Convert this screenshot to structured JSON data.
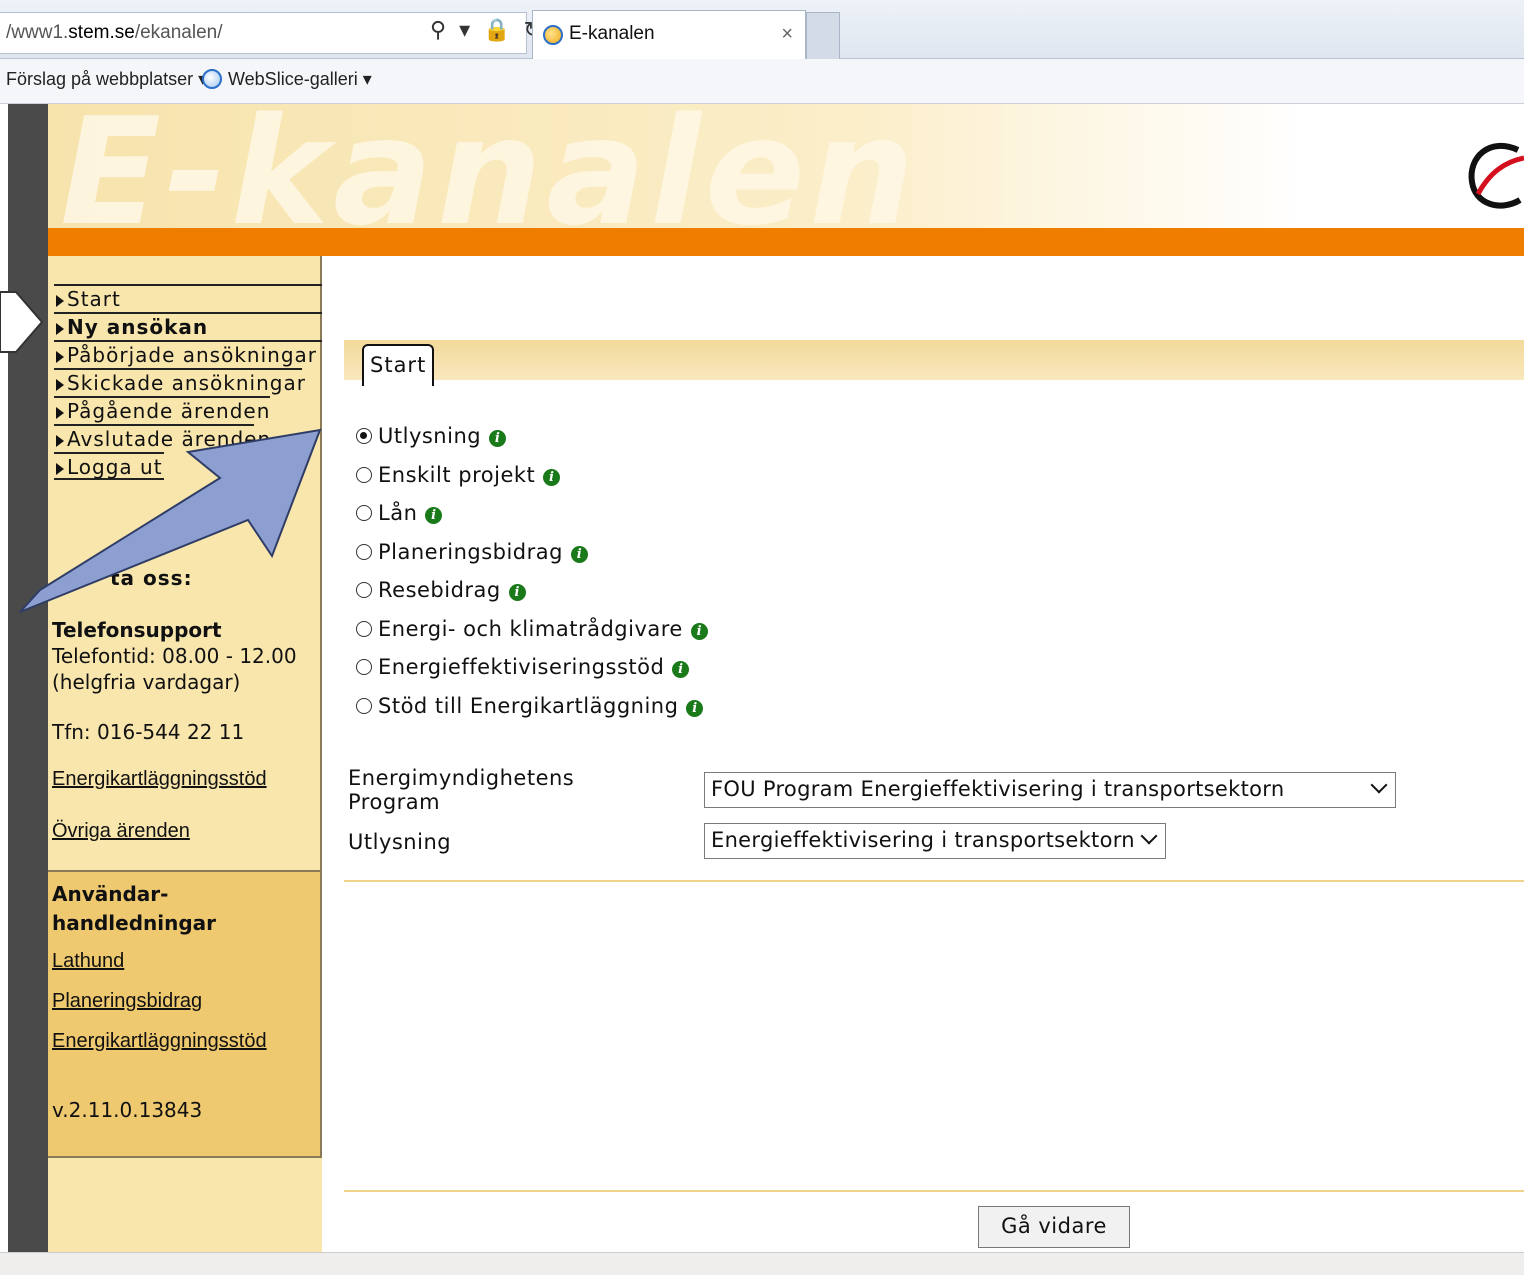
{
  "browser": {
    "url_prefix": "/www1.",
    "url_domain": "stem.se",
    "url_path": "/ekanalen/",
    "tab_title": "E-kanalen",
    "tab_close": "×",
    "fav_suggest": "Förslag på webbplatser ▾",
    "fav_webslice": "WebSlice-galleri ▾",
    "url_tools": "⚲ ▾ 🔒 ↻"
  },
  "header": {
    "logo": "E-kanalen"
  },
  "nav": {
    "items": [
      {
        "label": "Start"
      },
      {
        "label": "Ny ansökan"
      },
      {
        "label": "Påbörjade ansökningar"
      },
      {
        "label": "Skickade ansökningar"
      },
      {
        "label": "Pågående ärenden"
      },
      {
        "label": "Avslutade ärenden"
      },
      {
        "label": "Logga ut"
      }
    ]
  },
  "contact": {
    "title": "ta oss:",
    "support_title": "Telefonsupport",
    "hours": "Telefontid: 08.00 - 12.00",
    "days": "(helgfria vardagar)",
    "phone": "Tfn: 016-544 22 11",
    "link1": "Energikartläggningsstöd",
    "link2": "Övriga ärenden"
  },
  "guides": {
    "title_line1": "Användar-",
    "title_line2": "handledningar",
    "link1": "Lathund",
    "link2": "Planeringsbidrag",
    "link3": "Energikartläggningsstöd",
    "version": "v.2.11.0.13843"
  },
  "main": {
    "tab_label": "Start",
    "radios": [
      {
        "label": "Utlysning",
        "selected": true
      },
      {
        "label": "Enskilt projekt",
        "selected": false
      },
      {
        "label": "Lån",
        "selected": false
      },
      {
        "label": "Planeringsbidrag",
        "selected": false
      },
      {
        "label": "Resebidrag",
        "selected": false
      },
      {
        "label": "Energi- och klimatrådgivare",
        "selected": false
      },
      {
        "label": "Energieffektiviseringsstöd",
        "selected": false
      },
      {
        "label": "Stöd till Energikartläggning",
        "selected": false
      }
    ],
    "program_label_1": "Energimyndighetens",
    "program_label_2": "Program",
    "program_value": "FOU Program Energieffektivisering i transportsektorn",
    "utlysning_label": "Utlysning",
    "utlysning_value": "Energieffektivisering i transportsektorn",
    "next_button": "Gå vidare",
    "info_glyph": "i"
  },
  "slide_fragments": [
    "i",
    "s",
    "t"
  ],
  "colors": {
    "orange_bar": "#ee7d00",
    "sidebar": "#f8e6ad",
    "guides_bg": "#efc970",
    "arrow_fill": "#8c9fd0",
    "info_green": "#1a7a1a"
  }
}
